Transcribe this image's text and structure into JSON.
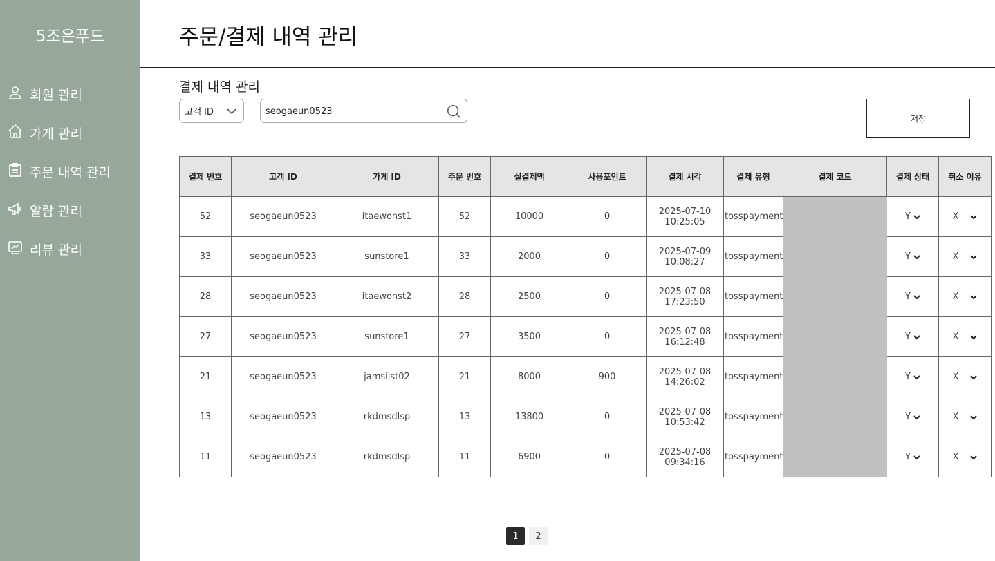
{
  "brand": "5조은푸드",
  "nav": [
    {
      "label": "회원 관리",
      "icon": "user-icon"
    },
    {
      "label": "가게 관리",
      "icon": "home-icon"
    },
    {
      "label": "주문 내역 관리",
      "icon": "clipboard-icon"
    },
    {
      "label": "알람 관리",
      "icon": "megaphone-icon"
    },
    {
      "label": "리뷰 관리",
      "icon": "review-icon"
    }
  ],
  "page_title": "주문/결제 내역 관리",
  "section_title": "결제 내역 관리",
  "filter": {
    "selected": "고객 ID"
  },
  "search": {
    "value": "seogaeun0523"
  },
  "save_label": "저장",
  "table": {
    "headers": [
      "결제 번호",
      "고객 ID",
      "가게 ID",
      "주문 번호",
      "실결제액",
      "사용포인트",
      "결제 시각",
      "결제 유형",
      "결제 코드",
      "결제 상태",
      "취소 이유"
    ],
    "rows": [
      {
        "pay_no": "52",
        "customer": "seogaeun0523",
        "store": "itaewonst1",
        "order_no": "52",
        "amount": "10000",
        "points": "0",
        "date": "2025-07-10",
        "time": "10:25:05",
        "type": "tosspayments",
        "status": "Y",
        "cancel": "X"
      },
      {
        "pay_no": "33",
        "customer": "seogaeun0523",
        "store": "sunstore1",
        "order_no": "33",
        "amount": "2000",
        "points": "0",
        "date": "2025-07-09",
        "time": "10:08:27",
        "type": "tosspayments",
        "status": "Y",
        "cancel": "X"
      },
      {
        "pay_no": "28",
        "customer": "seogaeun0523",
        "store": "itaewonst2",
        "order_no": "28",
        "amount": "2500",
        "points": "0",
        "date": "2025-07-08",
        "time": "17:23:50",
        "type": "tosspayments",
        "status": "Y",
        "cancel": "X"
      },
      {
        "pay_no": "27",
        "customer": "seogaeun0523",
        "store": "sunstore1",
        "order_no": "27",
        "amount": "3500",
        "points": "0",
        "date": "2025-07-08",
        "time": "16:12:48",
        "type": "tosspayments",
        "status": "Y",
        "cancel": "X"
      },
      {
        "pay_no": "21",
        "customer": "seogaeun0523",
        "store": "jamsilst02",
        "order_no": "21",
        "amount": "8000",
        "points": "900",
        "date": "2025-07-08",
        "time": "14:26:02",
        "type": "tosspayments",
        "status": "Y",
        "cancel": "X"
      },
      {
        "pay_no": "13",
        "customer": "seogaeun0523",
        "store": "rkdmsdlsp",
        "order_no": "13",
        "amount": "13800",
        "points": "0",
        "date": "2025-07-08",
        "time": "10:53:42",
        "type": "tosspayments",
        "status": "Y",
        "cancel": "X"
      },
      {
        "pay_no": "11",
        "customer": "seogaeun0523",
        "store": "rkdmsdlsp",
        "order_no": "11",
        "amount": "6900",
        "points": "0",
        "date": "2025-07-08",
        "time": "09:34:16",
        "type": "tosspayments",
        "status": "Y",
        "cancel": "X"
      }
    ]
  },
  "pagination": {
    "pages": [
      "1",
      "2"
    ],
    "current": "1"
  },
  "colors": {
    "sidebar": "#97a89a",
    "header_cell": "#e5e5e5",
    "redacted": "#c0c0c0",
    "active_page": "#2a2a2a"
  }
}
